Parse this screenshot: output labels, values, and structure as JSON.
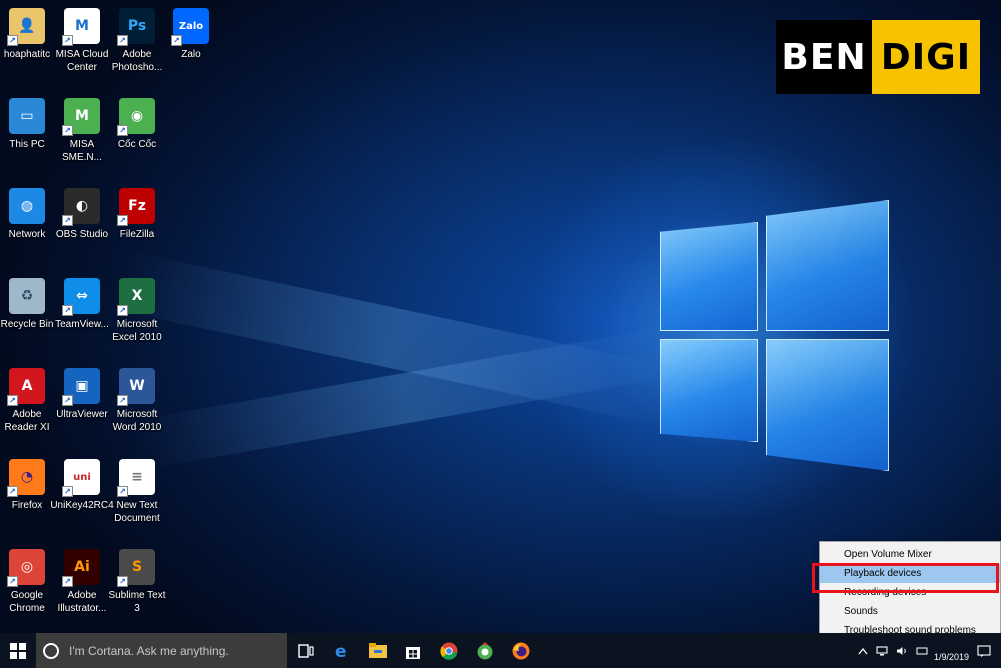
{
  "desktop": {
    "icons": [
      {
        "label": "hoaphatitc",
        "icon": "user-folder-icon"
      },
      {
        "label": "MISA Cloud\nCenter",
        "icon": "misa-cloud-icon"
      },
      {
        "label": "Adobe\nPhotosho...",
        "icon": "photoshop-icon"
      },
      {
        "label": "Zalo",
        "icon": "zalo-icon"
      },
      {
        "label": "This PC",
        "icon": "this-pc-icon"
      },
      {
        "label": "MISA\nSME.N...",
        "icon": "misa-sme-icon"
      },
      {
        "label": "Cốc Cốc",
        "icon": "coccoc-icon"
      },
      {
        "label": "Network",
        "icon": "network-icon"
      },
      {
        "label": "OBS Studio",
        "icon": "obs-icon"
      },
      {
        "label": "FileZilla",
        "icon": "filezilla-icon"
      },
      {
        "label": "Recycle Bin",
        "icon": "recycle-bin-icon"
      },
      {
        "label": "TeamView...",
        "icon": "teamviewer-icon"
      },
      {
        "label": "Microsoft\nExcel 2010",
        "icon": "excel-icon"
      },
      {
        "label": "Adobe\nReader XI",
        "icon": "adobe-reader-icon"
      },
      {
        "label": "UltraViewer",
        "icon": "ultraviewer-icon"
      },
      {
        "label": "Microsoft\nWord 2010",
        "icon": "word-icon"
      },
      {
        "label": "Firefox",
        "icon": "firefox-icon"
      },
      {
        "label": "UniKey42RC4",
        "icon": "unikey-icon"
      },
      {
        "label": "New Text\nDocument",
        "icon": "text-document-icon"
      },
      {
        "label": "Google\nChrome",
        "icon": "chrome-icon"
      },
      {
        "label": "Adobe\nIllustrator...",
        "icon": "illustrator-icon"
      },
      {
        "label": "Sublime Text\n3",
        "icon": "sublime-text-icon"
      }
    ]
  },
  "brand": {
    "left": "BEN",
    "right": "DIGI",
    "colors": {
      "dark": "#000000",
      "accent": "#f7c300"
    }
  },
  "context_menu": {
    "items": [
      {
        "label": "Open Volume Mixer"
      },
      {
        "label": "Playback devices",
        "selected": true
      },
      {
        "label": "Recording devices"
      },
      {
        "label": "Sounds"
      },
      {
        "label": "Troubleshoot sound problems"
      }
    ],
    "highlight_color": "#e8141c"
  },
  "taskbar": {
    "search_placeholder": "I'm Cortana. Ask me anything.",
    "pinned": [
      "task-view-icon",
      "edge-icon",
      "file-explorer-icon",
      "store-icon",
      "chrome-icon",
      "coccoc-icon",
      "firefox-icon"
    ],
    "clock_date": "1/9/2019"
  }
}
